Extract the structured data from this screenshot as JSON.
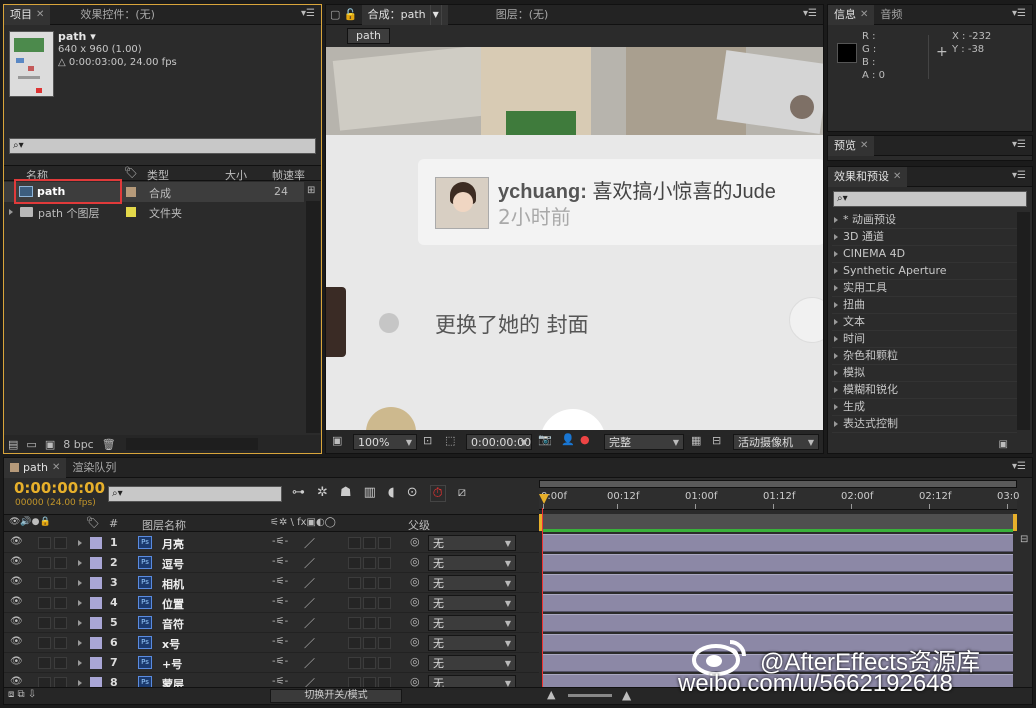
{
  "project_panel": {
    "tabs": [
      "项目",
      "效果控件：(无)"
    ],
    "item_name": "path ▾",
    "item_info1": "640 x 960 (1.00)",
    "item_info2": "△ 0:00:03:00, 24.00 fps",
    "search_placeholder": "⌕▾",
    "columns": [
      "名称",
      "类型",
      "大小",
      "帧速率"
    ],
    "items": [
      {
        "name": "path",
        "type": "合成",
        "size": "",
        "fps": "24",
        "label_color": "#b69a7a"
      },
      {
        "name": "path 个图层",
        "type": "文件夹",
        "size": "",
        "fps": "",
        "label_color": "#e3d84a"
      }
    ],
    "bpc": "8 bpc"
  },
  "comp_panel": {
    "tabs": [
      "合成：path",
      "图层：(无)"
    ],
    "breadcrumb": "path",
    "preview": {
      "user": "ychuang:",
      "message": "喜欢搞小惊喜的Jude",
      "time": "2小时前",
      "line2": "更换了她的 封面",
      "line3_partial": "        "
    },
    "zoom": "100%",
    "timecode": "0:00:00:00",
    "quality": "完整",
    "camera": "活动摄像机"
  },
  "info_panel": {
    "tabs": [
      "信息",
      "音频"
    ],
    "channels": [
      "R :",
      "G :",
      "B :",
      "A : 0"
    ],
    "x": "X : -232",
    "y": "Y : -38"
  },
  "preview_panel": {
    "tab": "预览"
  },
  "effects_panel": {
    "tab": "效果和预设",
    "search_placeholder": "⌕▾",
    "items": [
      "* 动画预设",
      "3D 通道",
      "CINEMA 4D",
      "Synthetic Aperture",
      "实用工具",
      "扭曲",
      "文本",
      "时间",
      "杂色和颗粒",
      "模拟",
      "模糊和锐化",
      "生成",
      "表达式控制"
    ]
  },
  "timeline": {
    "tabs": [
      "path",
      "渲染队列"
    ],
    "timecode": "0:00:00:00",
    "fps_label": "00000 (24.00 fps)",
    "search_placeholder": "⌕▾",
    "column_num": "#",
    "column_layer_name": "图层名称",
    "column_switches": "⚟✲ \\ fx▣◐◯",
    "column_parent": "父级",
    "ruler": [
      "0:00f",
      "00:12f",
      "01:00f",
      "01:12f",
      "02:00f",
      "02:12f",
      "03:0"
    ],
    "layers": [
      {
        "num": "1",
        "name": "月亮",
        "parent": "无"
      },
      {
        "num": "2",
        "name": "逗号",
        "parent": "无"
      },
      {
        "num": "3",
        "name": "相机",
        "parent": "无"
      },
      {
        "num": "4",
        "name": "位置",
        "parent": "无"
      },
      {
        "num": "5",
        "name": "音符",
        "parent": "无"
      },
      {
        "num": "6",
        "name": "x号",
        "parent": "无"
      },
      {
        "num": "7",
        "name": "+号",
        "parent": "无"
      },
      {
        "num": "8",
        "name": "蒙层",
        "parent": "无"
      }
    ],
    "toggle_mode": "切换开关/模式"
  },
  "watermark": {
    "line1": "@AfterEffects资源库",
    "line2": "weibo.com/u/5662192648"
  }
}
